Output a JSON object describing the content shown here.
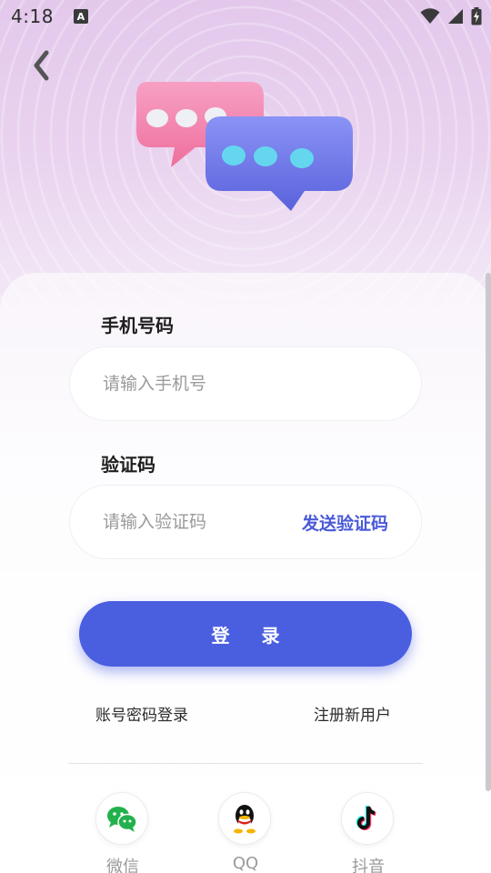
{
  "status_bar": {
    "time": "4:18",
    "app_badge": "A",
    "icons": [
      "wifi-icon",
      "signal-icon",
      "battery-charging-icon"
    ]
  },
  "header": {
    "back_icon": "chevron-left-icon",
    "hero_image": "chat-bubbles-illustration"
  },
  "form": {
    "phone_label": "手机号码",
    "phone_placeholder": "请输入手机号",
    "phone_value": "",
    "code_label": "验证码",
    "code_placeholder": "请输入验证码",
    "code_value": "",
    "send_code_label": "发送验证码",
    "login_label": "登 录"
  },
  "links": {
    "password_login": "账号密码登录",
    "register": "注册新用户"
  },
  "social": [
    {
      "label": "微信",
      "icon": "wechat-icon"
    },
    {
      "label": "QQ",
      "icon": "qq-icon"
    },
    {
      "label": "抖音",
      "icon": "douyin-icon"
    }
  ],
  "colors": {
    "accent": "#4a5ee0",
    "link_accent": "#4a5ad8",
    "wechat": "#22b14c"
  }
}
